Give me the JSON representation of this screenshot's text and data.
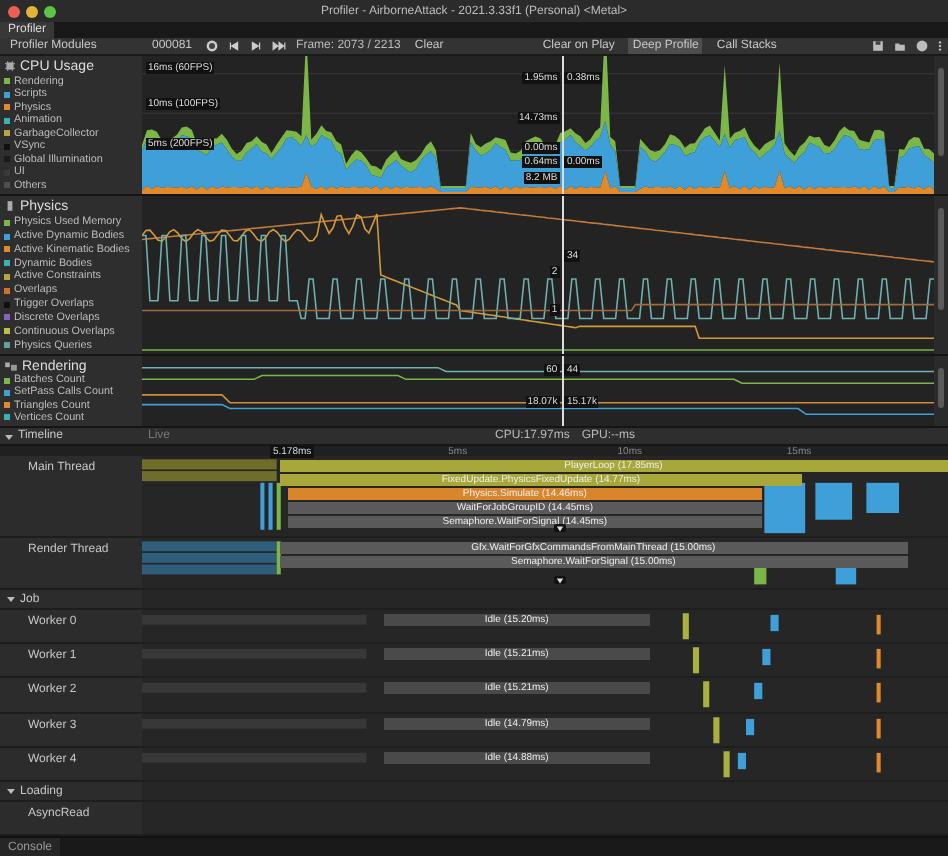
{
  "window": {
    "title": "Profiler - AirborneAttack - 2021.3.33f1 (Personal) <Metal>"
  },
  "tabs": [
    {
      "label": "Profiler",
      "selected": true
    }
  ],
  "toolbar": {
    "modules": "Profiler Modules",
    "target": "000081",
    "frame": "Frame: 2073 / 2213",
    "clear": "Clear",
    "clear_on_play": {
      "label": "Clear on Play",
      "on": false
    },
    "deep_profile": {
      "label": "Deep Profile",
      "on": true
    },
    "call_stacks": "Call Stacks"
  },
  "modules": [
    {
      "title": "CPU Usage",
      "kind": "area",
      "cursor_values": [
        "1.95ms",
        "0.38ms",
        "14.73ms",
        "0.00ms",
        "0.64ms",
        "0.00ms",
        "8.2 MB"
      ],
      "guides": [
        "16ms (60FPS)",
        "10ms (100FPS)",
        "5ms (200FPS)"
      ],
      "items": [
        {
          "label": "Rendering",
          "color": "#7ab648"
        },
        {
          "label": "Scripts",
          "color": "#3f9fd8"
        },
        {
          "label": "Physics",
          "color": "#e08a2c"
        },
        {
          "label": "Animation",
          "color": "#35b3b0"
        },
        {
          "label": "GarbageCollector",
          "color": "#b8a43c"
        },
        {
          "label": "VSync",
          "color": "#101010"
        },
        {
          "label": "Global Illumination",
          "color": "#1a1a1a"
        },
        {
          "label": "UI",
          "color": "#3a3a3a"
        },
        {
          "label": "Others",
          "color": "#505050"
        }
      ]
    },
    {
      "title": "Physics",
      "kind": "line",
      "cursor_values": [
        "34",
        "2",
        "1"
      ],
      "items": [
        {
          "label": "Physics Used Memory",
          "color": "#7ab648"
        },
        {
          "label": "Active Dynamic Bodies",
          "color": "#3f9fd8"
        },
        {
          "label": "Active Kinematic Bodies",
          "color": "#e08a2c"
        },
        {
          "label": "Dynamic Bodies",
          "color": "#35b3b0"
        },
        {
          "label": "Active Constraints",
          "color": "#b8a43c"
        },
        {
          "label": "Overlaps",
          "color": "#d07030"
        },
        {
          "label": "Trigger Overlaps",
          "color": "#101010"
        },
        {
          "label": "Discrete Overlaps",
          "color": "#8860c0"
        },
        {
          "label": "Continuous Overlaps",
          "color": "#c0c040"
        },
        {
          "label": "Physics Queries",
          "color": "#60a0a0"
        }
      ]
    },
    {
      "title": "Rendering",
      "kind": "line",
      "cursor_values": [
        "60",
        "44",
        "18.07k",
        "15.17k"
      ],
      "items": [
        {
          "label": "Batches Count",
          "color": "#7ab648"
        },
        {
          "label": "SetPass Calls Count",
          "color": "#3f9fd8"
        },
        {
          "label": "Triangles Count",
          "color": "#e08a2c"
        },
        {
          "label": "Vertices Count",
          "color": "#35b3b0"
        }
      ]
    }
  ],
  "timeline": {
    "title": "Timeline",
    "mode": "Live",
    "cpu": "CPU:17.97ms",
    "gpu": "GPU:--ms",
    "cursor": "5.178ms",
    "ruler": [
      "5ms",
      "10ms",
      "15ms"
    ],
    "threads": [
      {
        "name": "Main Thread",
        "kind": "thread",
        "bars": [
          {
            "label": "PlayerLoop (17.85ms)",
            "color": "#a8a83a"
          },
          {
            "label": "FixedUpdate.PhysicsFixedUpdate (14.77ms)",
            "color": "#a8a83a"
          },
          {
            "label": "Physics.Simulate (14.46ms)",
            "color": "#d9862a"
          },
          {
            "label": "WaitForJobGroupID (14.45ms)",
            "color": "#5a5a5a"
          },
          {
            "label": "Semaphore.WaitForSignal (14.45ms)",
            "color": "#5a5a5a"
          }
        ]
      },
      {
        "name": "Render Thread",
        "kind": "thread",
        "bars": [
          {
            "label": "Gfx.WaitForGfxCommandsFromMainThread (15.00ms)",
            "color": "#5a5a5a"
          },
          {
            "label": "Semaphore.WaitForSignal (15.00ms)",
            "color": "#5a5a5a"
          }
        ]
      },
      {
        "name": "Job",
        "kind": "group",
        "expanded": true
      },
      {
        "name": "Worker 0",
        "kind": "thread",
        "bars": [
          {
            "label": "Idle (15.20ms)",
            "color": "#4a4a4a"
          }
        ]
      },
      {
        "name": "Worker 1",
        "kind": "thread",
        "bars": [
          {
            "label": "Idle (15.21ms)",
            "color": "#4a4a4a"
          }
        ]
      },
      {
        "name": "Worker 2",
        "kind": "thread",
        "bars": [
          {
            "label": "Idle (15.21ms)",
            "color": "#4a4a4a"
          }
        ]
      },
      {
        "name": "Worker 3",
        "kind": "thread",
        "bars": [
          {
            "label": "Idle (14.79ms)",
            "color": "#4a4a4a"
          }
        ]
      },
      {
        "name": "Worker 4",
        "kind": "thread",
        "bars": [
          {
            "label": "Idle (14.88ms)",
            "color": "#4a4a4a"
          }
        ]
      },
      {
        "name": "Loading",
        "kind": "group",
        "expanded": true
      },
      {
        "name": "AsyncRead",
        "kind": "thread"
      }
    ]
  },
  "bottom_tabs": [
    {
      "label": "Console",
      "selected": false
    }
  ]
}
